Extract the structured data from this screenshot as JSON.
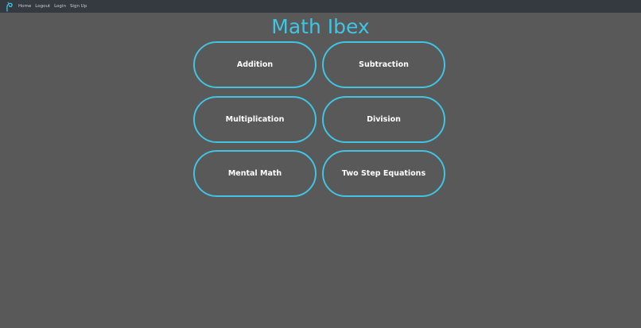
{
  "nav": {
    "logo_icon": "ibex-logo-icon",
    "links": [
      "Home",
      "Logout",
      "Login",
      "Sign Up"
    ]
  },
  "title": "Math Ibex",
  "topics": [
    "Addition",
    "Subtraction",
    "Multiplication",
    "Division",
    "Mental Math",
    "Two Step Equations"
  ],
  "colors": {
    "accent": "#40c4e2",
    "background": "#595959",
    "navbar": "#343a40",
    "tile_text": "#ffffff"
  }
}
